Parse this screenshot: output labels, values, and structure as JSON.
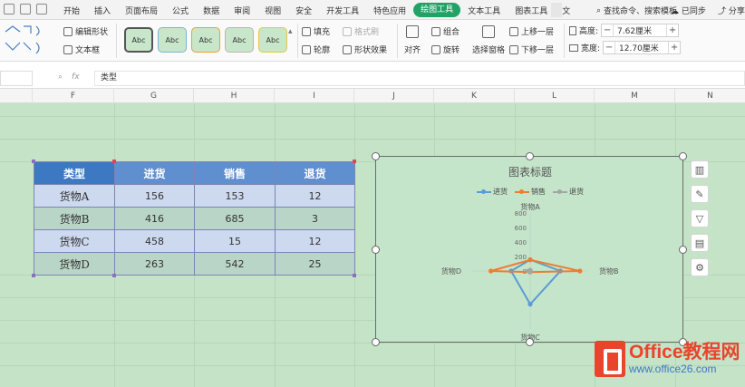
{
  "menubar": {
    "items": [
      "开始",
      "插入",
      "页面布局",
      "公式",
      "数据",
      "审阅",
      "视图",
      "安全",
      "开发工具",
      "特色应用",
      "绘图工具",
      "文本工具",
      "图表工具",
      "文"
    ],
    "search": "查找命令、搜索模板",
    "sync": "已同步",
    "share": "分享"
  },
  "ribbon": {
    "edit_shape": "编辑形状",
    "text_box": "文本框",
    "preset_label": "Abc",
    "fill": "填充",
    "fill_format": "格式刷",
    "outline": "轮廓",
    "shape_effects": "形状效果",
    "align": "对齐",
    "group": "组合",
    "rotate": "旋转",
    "selection_pane": "选择窗格",
    "bring_forward": "上移一层",
    "send_backward": "下移一层",
    "height_label": "高度:",
    "height_value": "7.62厘米",
    "width_label": "宽度:",
    "width_value": "12.70厘米"
  },
  "formula": {
    "fx": "fx",
    "content": "类型"
  },
  "columns": [
    "F",
    "G",
    "H",
    "I",
    "J",
    "K",
    "L",
    "M",
    "N"
  ],
  "table": {
    "headers": [
      "类型",
      "进货",
      "销售",
      "退货"
    ],
    "rows": [
      [
        "货物A",
        "156",
        "153",
        "12"
      ],
      [
        "货物B",
        "416",
        "685",
        "3"
      ],
      [
        "货物C",
        "458",
        "15",
        "12"
      ],
      [
        "货物D",
        "263",
        "542",
        "25"
      ]
    ]
  },
  "chart_data": {
    "type": "radar",
    "title": "图表标题",
    "categories": [
      "货物A",
      "货物B",
      "货物C",
      "货物D"
    ],
    "axis_ticks": [
      "0",
      "200",
      "400",
      "600",
      "800"
    ],
    "rmax": 800,
    "legend_position": "top",
    "series": [
      {
        "name": "进货",
        "values": [
          156,
          416,
          458,
          263
        ],
        "color": "#5b9bd5"
      },
      {
        "name": "销售",
        "values": [
          153,
          685,
          15,
          542
        ],
        "color": "#ed7d31"
      },
      {
        "name": "退货",
        "values": [
          12,
          3,
          12,
          25
        ],
        "color": "#a5a5a5"
      }
    ]
  },
  "colors": {
    "active_tab": "#21a366",
    "sheet_bg": "#c5e3c7",
    "header_fill": "#5f8fcf",
    "watermark": "#e8452c"
  },
  "watermark": {
    "brand": "Office教程网",
    "url": "www.office26.com"
  }
}
